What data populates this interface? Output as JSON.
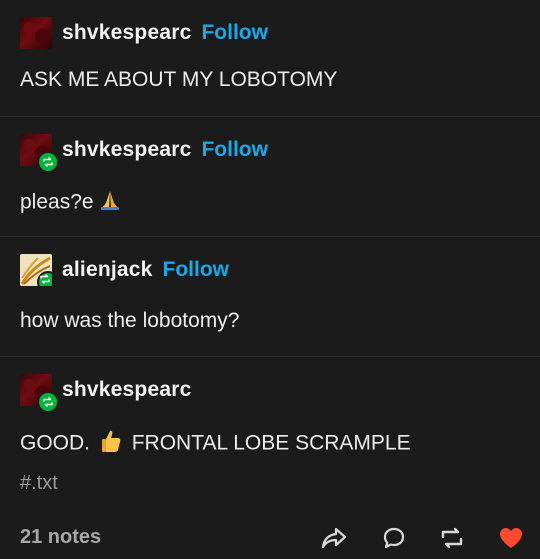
{
  "posts": [
    {
      "username": "shvkespearc",
      "follow_label": "Follow",
      "text": "ASK ME ABOUT MY LOBOTOMY",
      "avatar": "dark-red-image",
      "reblogged": false
    },
    {
      "username": "shvkespearc",
      "follow_label": "Follow",
      "text": "pleas?e",
      "emoji": "folded-hands-icon",
      "avatar": "dark-red-image",
      "reblogged": true
    },
    {
      "username": "alienjack",
      "follow_label": "Follow",
      "text": "how was the lobotomy?",
      "avatar": "gold-swirl-image",
      "reblogged": true
    },
    {
      "username": "shvkespearc",
      "text_before": "GOOD.",
      "emoji": "thumbs-up-icon",
      "text_after": "FRONTAL LOBE SCRAMPLE",
      "avatar": "dark-red-image",
      "reblogged": true
    }
  ],
  "tags": [
    "#.txt"
  ],
  "footer": {
    "notes": "21 notes",
    "actions": [
      "share-icon",
      "reply-icon",
      "reblog-icon",
      "like-icon"
    ]
  },
  "colors": {
    "background": "#1b1b1b",
    "follow": "#1aa9e6",
    "reblog_badge": "#00b53b",
    "like": "#ff4930"
  }
}
